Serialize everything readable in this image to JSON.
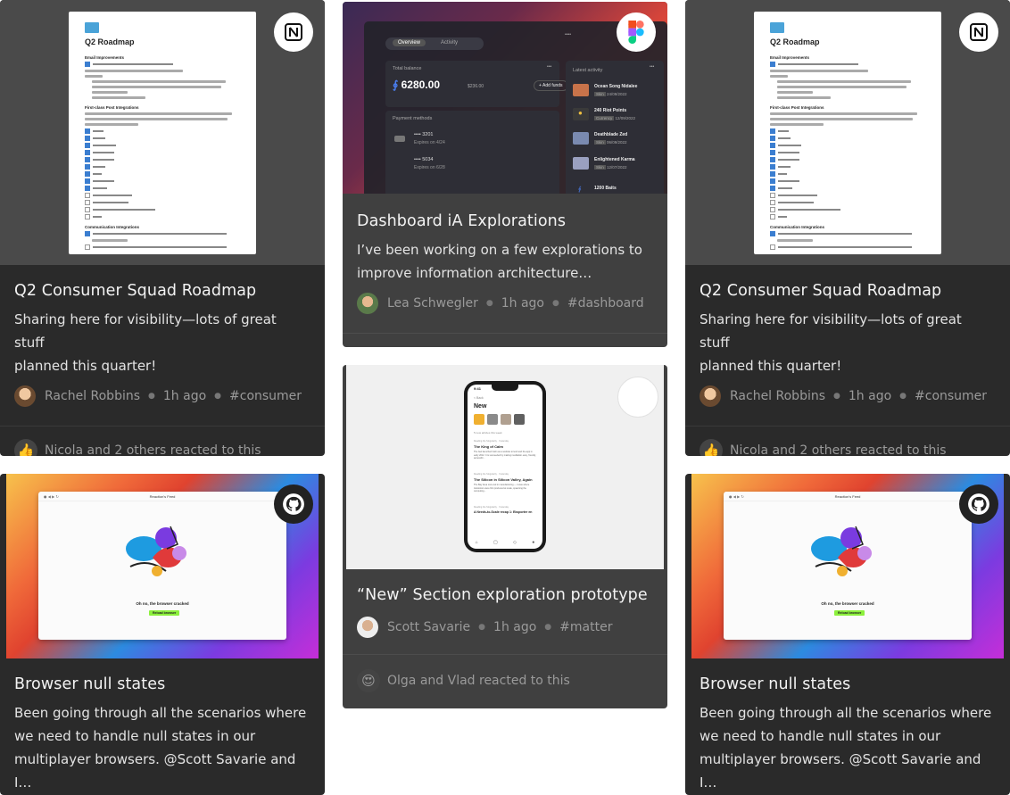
{
  "cards": [
    {
      "title": "Q2 Consumer Squad Roadmap",
      "desc_line1": "Sharing here for visibility—lots of great stuff",
      "desc_line2": "planned this quarter!",
      "author": "Rachel Robbins",
      "time": "1h ago",
      "tag": "#consumer",
      "reaction": "Nicola and 2 others reacted to this",
      "reaction_emoji": "👍",
      "source_icon": "notion-icon",
      "doc": {
        "heading": "Q2 Roadmap",
        "section1": "Email Improvements",
        "section2": "First-class Post Integrations",
        "section3": "Communication Integrations"
      }
    },
    {
      "title": "Dashboard iA Explorations",
      "desc_line1": "I’ve been working on a few explorations to",
      "desc_line2": "improve information architecture…",
      "author": "Lea Schwegler",
      "time": "1h ago",
      "tag": "#dashboard",
      "source_icon": "figma-icon",
      "dashboard": {
        "tab1": "Overview",
        "tab2": "Activity",
        "total_label": "Total balance",
        "balance": "6280.00",
        "balance_sub": "$236.00",
        "add_funds": "+ Add funds",
        "payment_label": "Payment methods",
        "card1": "•••• 3201",
        "card1_exp": "Expires on 4/24",
        "card2": "•••• 5034",
        "card2_exp": "Expires on 6/28",
        "activity_label": "Latest activity",
        "activity": [
          {
            "name": "Ocean Song Nidalee",
            "tag": "Skin",
            "date": "24/09/2022"
          },
          {
            "name": "240 Riot Points",
            "tag": "Currency",
            "date": "12/09/2022"
          },
          {
            "name": "Deathblade Zed",
            "tag": "Skin",
            "date": "06/09/2022"
          },
          {
            "name": "Enlightened Karma",
            "tag": "Skin",
            "date": "12/07/2022"
          },
          {
            "name": "1200 Baits",
            "tag": "",
            "date": ""
          }
        ]
      }
    },
    {
      "title": "Q2 Consumer Squad Roadmap",
      "desc_line1": "Sharing here for visibility—lots of great stuff",
      "desc_line2": "planned this quarter!",
      "author": "Rachel Robbins",
      "time": "1h ago",
      "tag": "#consumer",
      "reaction": "Nicola and 2 others reacted to this",
      "reaction_emoji": "👍",
      "source_icon": "notion-icon",
      "doc": {
        "heading": "Q2 Roadmap",
        "section1": "Email Improvements",
        "section2": "First-class Post Integrations",
        "section3": "Communication Integrations"
      }
    },
    {
      "title": "Browser null states",
      "desc_line1": "Been going through all the scenarios where",
      "desc_line2": "we need to handle null states in our",
      "desc_line3": "multiplayer browsers. @Scott Savarie and I…",
      "source_icon": "github-icon",
      "browser": {
        "window_title": "Reaction's Feed",
        "message": "Oh no, the browser cracked",
        "button": "Reload browser"
      }
    },
    {
      "title": "“New” Section exploration prototype",
      "author": "Scott Savarie",
      "time": "1h ago",
      "tag": "#matter",
      "reaction": "Olga and Vlad reacted to this",
      "reaction_emoji": "😍",
      "phone": {
        "time": "9:41",
        "back": "< Back",
        "heading": "New",
        "sub": "5 new articles this week",
        "items": [
          {
            "source": "Reading the Singularity · Yesterday",
            "title": "The King of Calm",
            "body": "The feel launched Calm as a website to lend and the app in early 2012. It is succeeded by making meditation easy, friendly, accessibl…"
          },
          {
            "source": "Reading the Singularity · Yesterday",
            "title": "The Silicon in Silicon Valley, Again",
            "body": "The Bay Area once led in manufacturing — it was where transistors were first produced at scale, spawning the computing…"
          },
          {
            "source": "Reading the Singularity · Yesterday",
            "title": "A Needs-to-Scale recap 1: Eksporter en",
            "body": ""
          }
        ]
      }
    },
    {
      "title": "Browser null states",
      "desc_line1": "Been going through all the scenarios where",
      "desc_line2": "we need to handle null states in our",
      "desc_line3": "multiplayer browsers. @Scott Savarie and I…",
      "source_icon": "github-icon",
      "browser": {
        "window_title": "Reaction's Feed",
        "message": "Oh no, the browser cracked",
        "button": "Reload browser"
      }
    }
  ]
}
